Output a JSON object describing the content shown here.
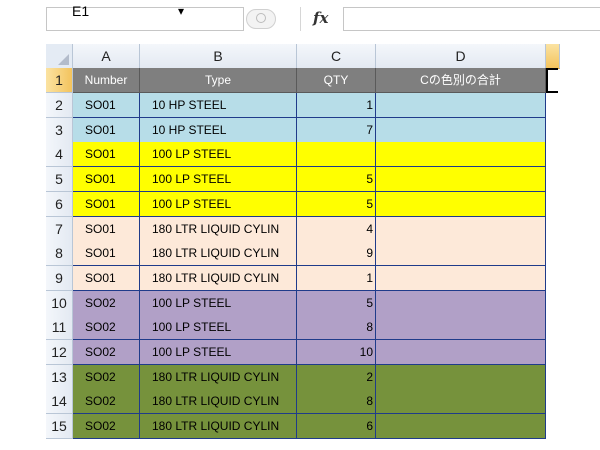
{
  "formula_bar": {
    "name_box": "E1",
    "name_box_arrow": "▾",
    "fx_label": "fx",
    "formula": ""
  },
  "columns": [
    "A",
    "B",
    "C",
    "D"
  ],
  "header_row": {
    "row_number": "1",
    "cells": [
      "Number",
      "Type",
      "QTY",
      "Cの色別の合計"
    ]
  },
  "rows": [
    {
      "row": "2",
      "number": "SO01",
      "type": "10 HP STEEL",
      "qty": "1",
      "fill": "#b7dde8"
    },
    {
      "row": "3",
      "number": "SO01",
      "type": "10 HP STEEL",
      "qty": "7",
      "fill": "#b7dde8"
    },
    {
      "row": "4",
      "number": "SO01",
      "type": "100 LP STEEL",
      "qty": "",
      "fill": "#ffff00"
    },
    {
      "row": "5",
      "number": "SO01",
      "type": "100 LP STEEL",
      "qty": "5",
      "fill": "#ffff00"
    },
    {
      "row": "6",
      "number": "SO01",
      "type": "100 LP STEEL",
      "qty": "5",
      "fill": "#ffff00"
    },
    {
      "row": "7",
      "number": "SO01",
      "type": "180 LTR LIQUID CYLIN",
      "qty": "4",
      "fill": "#fde9d9"
    },
    {
      "row": "8",
      "number": "SO01",
      "type": "180 LTR LIQUID CYLIN",
      "qty": "9",
      "fill": "#fde9d9"
    },
    {
      "row": "9",
      "number": "SO01",
      "type": "180 LTR LIQUID CYLIN",
      "qty": "1",
      "fill": "#fde9d9"
    },
    {
      "row": "10",
      "number": "SO02",
      "type": "100 LP STEEL",
      "qty": "5",
      "fill": "#b1a0c7"
    },
    {
      "row": "11",
      "number": "SO02",
      "type": "100 LP STEEL",
      "qty": "8",
      "fill": "#b1a0c7"
    },
    {
      "row": "12",
      "number": "SO02",
      "type": "100 LP STEEL",
      "qty": "10",
      "fill": "#b1a0c7"
    },
    {
      "row": "13",
      "number": "SO02",
      "type": "180 LTR LIQUID CYLIN",
      "qty": "2",
      "fill": "#76923c"
    },
    {
      "row": "14",
      "number": "SO02",
      "type": "180 LTR LIQUID CYLIN",
      "qty": "8",
      "fill": "#76923c"
    },
    {
      "row": "15",
      "number": "SO02",
      "type": "180 LTR LIQUID CYLIN",
      "qty": "6",
      "fill": "#76923c"
    }
  ],
  "colors": {
    "header_fill": "#7f7f7f",
    "grid_border": "#1f3b8a",
    "selected_header": "#f3c35d"
  }
}
